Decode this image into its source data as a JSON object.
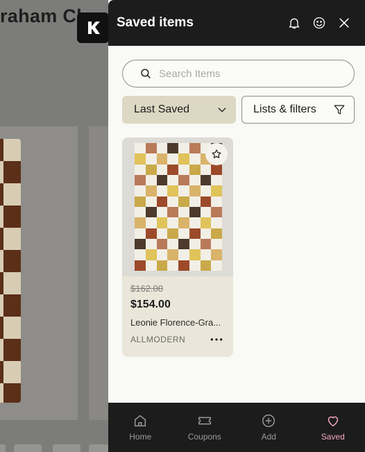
{
  "background": {
    "title": "raham Cl"
  },
  "panel": {
    "title": "Saved items"
  },
  "search": {
    "placeholder": "Search Items"
  },
  "sort": {
    "label": "Last Saved"
  },
  "filters": {
    "label": "Lists & filters"
  },
  "items": [
    {
      "old_price": "$162.00",
      "price": "$154.00",
      "name": "Leonie Florence-Gra...",
      "store": "ALLMODERN"
    }
  ],
  "nav": [
    {
      "label": "Home",
      "icon": "home-icon"
    },
    {
      "label": "Coupons",
      "icon": "ticket-icon"
    },
    {
      "label": "Add",
      "icon": "plus-circle-icon"
    },
    {
      "label": "Saved",
      "icon": "heart-icon"
    }
  ],
  "colors": {
    "header_bg": "#1c1c1c",
    "panel_bg": "#f9f9f6",
    "sort_bg": "#ddd8c3",
    "card_bg": "#eae6d9",
    "active_nav": "#f4a8c6"
  }
}
